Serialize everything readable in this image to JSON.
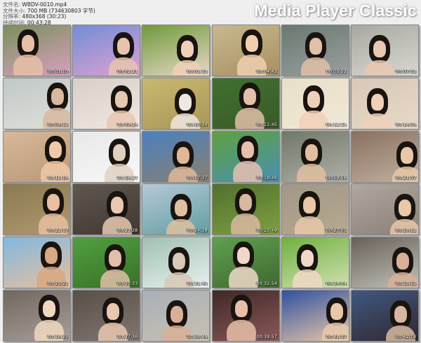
{
  "header": {
    "file_name_label": "文件名:",
    "file_name": "WBDV-0010.mp4",
    "file_size_label": "文件大小:",
    "file_size": "700 MB (734630803 字节)",
    "resolution_label": "分辨率:",
    "resolution": "480x368 (30:23)",
    "duration_label": "持续时间:",
    "duration": "00:43:28"
  },
  "brand": "Media Player Classic",
  "thumbnails": [
    "00:01:10",
    "00:02:21",
    "00:03:33",
    "00:04:42",
    "00:05:52",
    "00:07:03",
    "00:08:13",
    "00:09:24",
    "00:10:34",
    "00:11:45",
    "00:12:55",
    "00:14:06",
    "00:15:16",
    "00:16:27",
    "00:17:37",
    "00:18:46",
    "00:19:56",
    "00:21:07",
    "00:22:17",
    "00:23:28",
    "00:24:38",
    "00:25:49",
    "00:27:01",
    "00:28:12",
    "00:29:22",
    "00:30:33",
    "00:31:43",
    "00:32:54",
    "00:34:04",
    "00:35:15",
    "00:36:25",
    "00:37:36",
    "00:38:46",
    "00:39:57",
    "00:41:07",
    "00:42:18"
  ]
}
